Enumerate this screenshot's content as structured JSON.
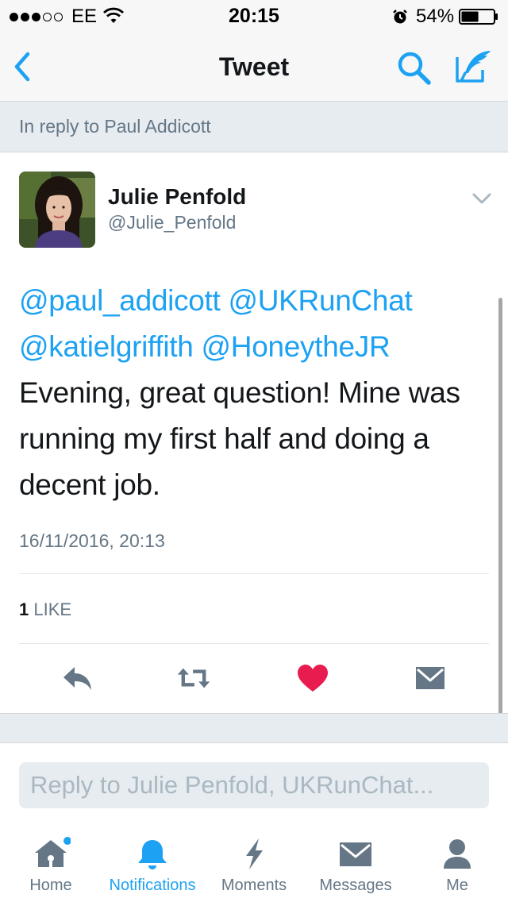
{
  "status_bar": {
    "signal_dots": {
      "filled": 3,
      "total": 5
    },
    "carrier": "EE",
    "time": "20:15",
    "battery_percent": "54%",
    "battery_level": 0.54,
    "icons": [
      "wifi-icon",
      "alarm-icon",
      "battery-icon"
    ]
  },
  "nav": {
    "title": "Tweet",
    "icons": [
      "back-chevron-icon",
      "search-icon",
      "compose-icon"
    ]
  },
  "reply_context": "In reply to Paul Addicott",
  "tweet": {
    "author_name": "Julie Penfold",
    "author_handle": "@Julie_Penfold",
    "lines": [
      {
        "mentions": [
          "@paul_addicott",
          "@UKRunChat"
        ]
      },
      {
        "mentions": [
          "@katielgriffith",
          "@HoneytheJR"
        ]
      },
      {
        "text": "Evening, great question! Mine was"
      },
      {
        "text": "running my first half and doing a"
      },
      {
        "text": "decent job."
      }
    ],
    "timestamp": "16/11/2016, 20:13",
    "like_count": "1",
    "like_label": "LIKE"
  },
  "actions": [
    "reply-icon",
    "retweet-icon",
    "like-heart-icon",
    "direct-message-icon"
  ],
  "reply_input": {
    "placeholder": "Reply to Julie Penfold, UKRunChat..."
  },
  "tabs": [
    {
      "label": "Home",
      "icon": "home-icon",
      "active": false,
      "badge": true
    },
    {
      "label": "Notifications",
      "icon": "bell-icon",
      "active": true
    },
    {
      "label": "Moments",
      "icon": "lightning-icon",
      "active": false
    },
    {
      "label": "Messages",
      "icon": "envelope-icon",
      "active": false
    },
    {
      "label": "Me",
      "icon": "person-icon",
      "active": false
    }
  ],
  "colors": {
    "accent": "#1da1f2",
    "like": "#e81c4f",
    "secondary_text": "#657786",
    "icon_grey": "#657786",
    "banner_bg": "#e6ecf0"
  }
}
